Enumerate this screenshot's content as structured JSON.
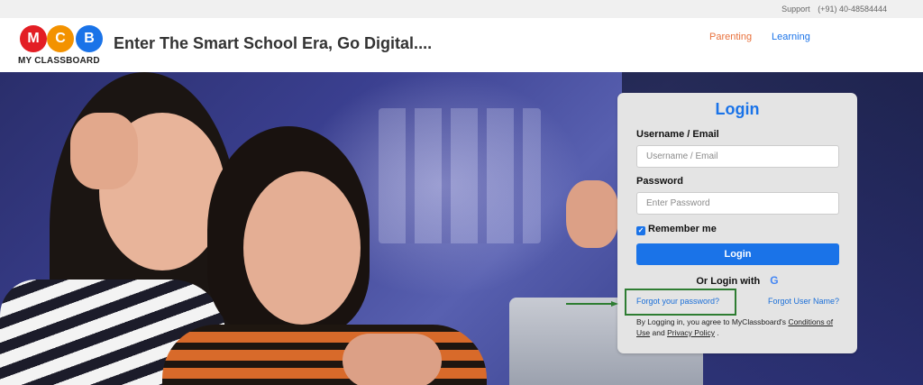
{
  "topbar": {
    "support_label": "Support",
    "phone": "(+91) 40-48584444"
  },
  "header": {
    "logo_letters": [
      "M",
      "C",
      "B"
    ],
    "brand_name": "MY CLASSBOARD",
    "tagline": "Enter The Smart School Era, Go Digital....",
    "nav": [
      {
        "label": "Parenting",
        "color": "#e8713c"
      },
      {
        "label": "Learning",
        "color": "#1a73e8"
      }
    ]
  },
  "login": {
    "title": "Login",
    "username_label": "Username / Email",
    "username_placeholder": "Username / Email",
    "username_value": "",
    "password_label": "Password",
    "password_placeholder": "Enter Password",
    "password_value": "",
    "remember_label": "Remember me",
    "remember_checked": true,
    "button_label": "Login",
    "or_login_with": "Or Login with",
    "google_icon": "G",
    "forgot_password": "Forgot your password?",
    "forgot_username": "Forgot User Name?",
    "terms_prefix": "By Logging in, you agree to MyClassboard's",
    "terms_link1": "Conditions of Use",
    "terms_and": "and",
    "terms_link2": "Privacy Policy",
    "terms_suffix": "."
  },
  "colors": {
    "accent": "#1a73e8",
    "highlight": "#2e7d32"
  }
}
